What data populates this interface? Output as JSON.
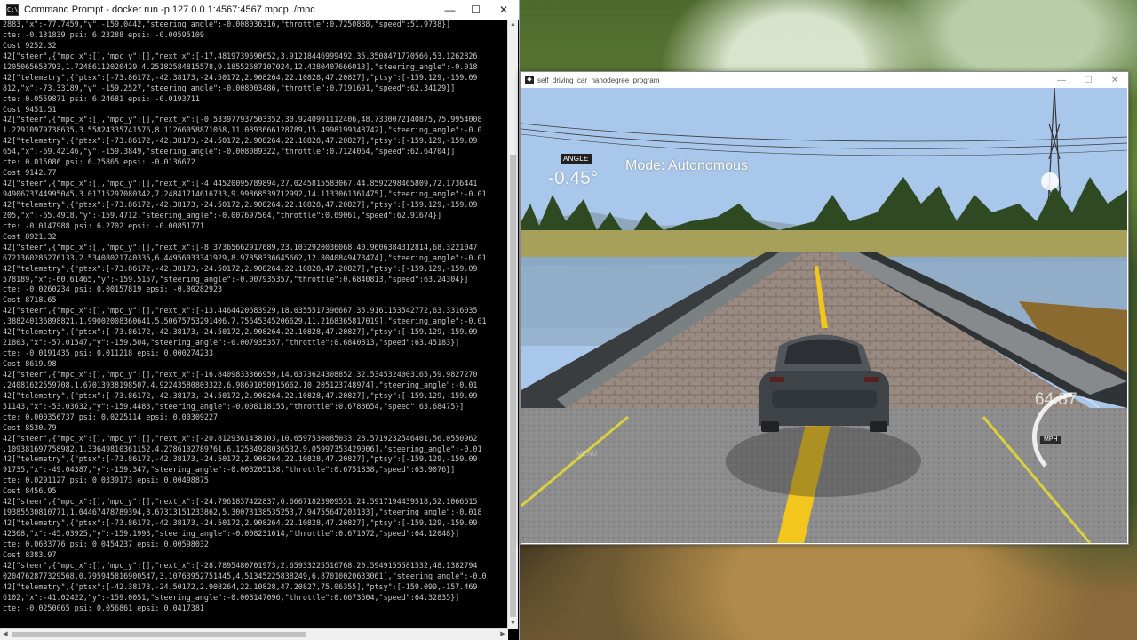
{
  "cmd_window": {
    "title": "Command Prompt - docker  run -p 127.0.0.1:4567:4567 mpcp ./mpc",
    "minimize_glyph": "—",
    "maximize_glyph": "☐",
    "close_glyph": "✕",
    "icon_text": "C:\\",
    "lines": [
      "2883,\"x\":-77.7459,\"y\":-159.0442,\"steering_angle\":-0.008036316,\"throttle\":0.7250888,\"speed\":51.9738}]",
      "cte: -0.131839 psi: 6.23288 epsi: -0.00595109",
      "Cost 9252.32",
      "42[\"steer\",{\"mpc_x\":[],\"mpc_y\":[],\"next_x\":[-17.4819739690652,3.91218446999492,35.3508471770566,53.1262826",
      "1205065653793,1.72486112020429,4.25182584815578,9.18552687107024,12.4280407666013],\"steering_angle\":-0.018",
      "42[\"telemetry\",{\"ptsx\":[-73.86172,-42.38173,-24.50172,2.908264,22.10828,47.20827],\"ptsy\":[-159.129,-159.09",
      "812,\"x\":-73.33189,\"y\":-159.2527,\"steering_angle\":-0.008003486,\"throttle\":0.7191691,\"speed\":62.34129}]",
      "cte: 0.0559871 psi: 6.24681 epsi: -0.0193711",
      "Cost 9451.51",
      "42[\"steer\",{\"mpc_x\":[],\"mpc_y\":[],\"next_x\":[-0.533977937503352,30.9240991112406,48.7330072140875,75.9954008",
      "1.27910979738635,3.55824335741576,8.11266058871058,11.0893666128789,15.4998199348742],\"steering_angle\":-0.0",
      "42[\"telemetry\",{\"ptsx\":[-73.86172,-42.38173,-24.50172,2.908264,22.10828,47.20827],\"ptsy\":[-159.129,-159.09",
      "654,\"x\":-69.42146,\"y\":-159.3849,\"steering_angle\":-0.008089322,\"throttle\":0.7124064,\"speed\":62.64704}]",
      "cte: 0.015086 psi: 6.25865 epsi: -0.0136672",
      "Cost 9142.77",
      "42[\"steer\",{\"mpc_x\":[],\"mpc_y\":[],\"next_x\":[-4.44520095789894,27.0245815583067,44.8592298465809,72.1736441",
      "9490673744995045,3.01715297080342,7.24841714616733,9.99868539712992,14.1133061361475],\"steering_angle\":-0.01",
      "42[\"telemetry\",{\"ptsx\":[-73.86172,-42.38173,-24.50172,2.908264,22.10828,47.20827],\"ptsy\":[-159.129,-159.09",
      "205,\"x\":-65.4918,\"y\":-159.4712,\"steering_angle\":-0.007697504,\"throttle\":0.69061,\"speed\":62.91674}]",
      "cte: -0.0147988 psi: 6.2702 epsi: -0.00851771",
      "Cost 8921.32",
      "42[\"steer\",{\"mpc_x\":[],\"mpc_y\":[],\"next_x\":[-8.37365662917689,23.1032920036068,40.9606384312814,68.3221047",
      "6721360286276133,2.53408021740335,6.44956033341929,8.97858336645662,12.8040849473474],\"steering_angle\":-0.01",
      "42[\"telemetry\",{\"ptsx\":[-73.86172,-42.38173,-24.50172,2.908264,22.10828,47.20827],\"ptsy\":[-159.129,-159.09",
      "578189,\"x\":-60.61465,\"y\":-159.5157,\"steering_angle\":-0.007935357,\"throttle\":0.6840813,\"speed\":63.24304}]",
      "cte: -0.0260234 psi: 0.00157819 epsi: -0.00282923",
      "Cost 8718.65",
      "42[\"steer\",{\"mpc_x\":[],\"mpc_y\":[],\"next_x\":[-13.4464420683929,18.0355517396667,35.9161153542772,63.3316035",
      ".388240136898821,1.99002008360641,5.50675753291406,7.75645345206629,11.2168365817019],\"steering_angle\":-0.01",
      "42[\"telemetry\",{\"ptsx\":[-73.86172,-42.38173,-24.50172,2.908264,22.10828,47.20827],\"ptsy\":[-159.129,-159.09",
      "21803,\"x\":-57.01547,\"y\":-159.504,\"steering_angle\":-0.007935357,\"throttle\":0.6840813,\"speed\":63.45183}]",
      "cte: -0.0191435 psi: 0.011218 epsi: 0.000274233",
      "Cost 8619.98",
      "42[\"steer\",{\"mpc_x\":[],\"mpc_y\":[],\"next_x\":[-16.8409833366959,14.6373624308852,32.5345324003165,59.9827270",
      ".24081622559708,1.67013938198507,4.92243580803322,6.98691050915662,10.205123748974],\"steering_angle\":-0.01",
      "42[\"telemetry\",{\"ptsx\":[-73.86172,-42.38173,-24.50172,2.908264,22.10828,47.20827],\"ptsy\":[-159.129,-159.09",
      "51143,\"x\":-53.03632,\"y\":-159.4483,\"steering_angle\":-0.008118155,\"throttle\":0.6788654,\"speed\":63.68475}]",
      "cte: 0.000356737 psi: 0.0225114 epsi: 0.00309227",
      "Cost 8530.79",
      "42[\"steer\",{\"mpc_x\":[],\"mpc_y\":[],\"next_x\":[-20.8129361438103,10.6597530085033,28.5719232546401,56.0550962",
      ".109381697758982,1.33649810361152,4.2786102789761,6.12584928036532,9.05997353429006],\"steering_angle\":-0.01",
      "42[\"telemetry\",{\"ptsx\":[-73.86172,-42.38173,-24.50172,2.908264,22.10828,47.20827],\"ptsy\":[-159.129,-159.09",
      "91735,\"x\":-49.04387,\"y\":-159.347,\"steering_angle\":-0.008205138,\"throttle\":0.6751838,\"speed\":63.9076}]",
      "cte: 0.0291127 psi: 0.0339173 epsi: 0.00498875",
      "Cost 8456.95",
      "42[\"steer\",{\"mpc_x\":[],\"mpc_y\":[],\"next_x\":[-24.7961837422837,6.66671823909551,24.5917194439518,52.1066615",
      "19385530810771,1.04467478789394,3.67313151233862,5.30073138535253,7.94755647203133],\"steering_angle\":-0.018",
      "42[\"telemetry\",{\"ptsx\":[-73.86172,-42.38173,-24.50172,2.908264,22.10828,47.20827],\"ptsy\":[-159.129,-159.09",
      "42368,\"x\":-45.03925,\"y\":-159.1993,\"steering_angle\":-0.008231614,\"throttle\":0.671072,\"speed\":64.12048}]",
      "cte: 0.0633776 psi: 0.0454237 epsi: 0.00598032",
      "Cost 8383.97",
      "42[\"steer\",{\"mpc_x\":[],\"mpc_y\":[],\"next_x\":[-28.7895480701973,2.65933225516768,20.5949155581532,48.1382794",
      "0204762877329568,0.795945816900547,3.10763952751445,4.51345225838249,6.87010020633061],\"steering_angle\":-0.0",
      "42[\"telemetry\",{\"ptsx\":[-42.38173,-24.50172,2.908264,22.10828,47.20827,75.06355],\"ptsy\":[-159.099,-157.469",
      "6102,\"x\":-41.02422,\"y\":-159.0051,\"steering_angle\":-0.008147096,\"throttle\":0.6673504,\"speed\":64.32835}]",
      "cte: -0.0250065 psi: 0.056861 epsi: 0.0417381"
    ],
    "scroll_up": "▲",
    "scroll_down": "▼",
    "scroll_left": "◀",
    "scroll_right": "▶"
  },
  "sim_window": {
    "title": "self_driving_car_nanodegree_program",
    "minimize_glyph": "—",
    "maximize_glyph": "☐",
    "close_glyph": "✕",
    "hud": {
      "angle_label": "ANGLE",
      "angle_value": "-0.45°",
      "mode_text": "Mode: Autonomous",
      "speed_value": "64.37",
      "speed_unit": "MPH",
      "faint_text": "MENU"
    },
    "colors": {
      "sky": "#a9c7ea",
      "water": "#8aa9c6",
      "road_center": "#9a8f86",
      "centerline": "#f2c61c",
      "car_body": "#3e4348"
    }
  }
}
